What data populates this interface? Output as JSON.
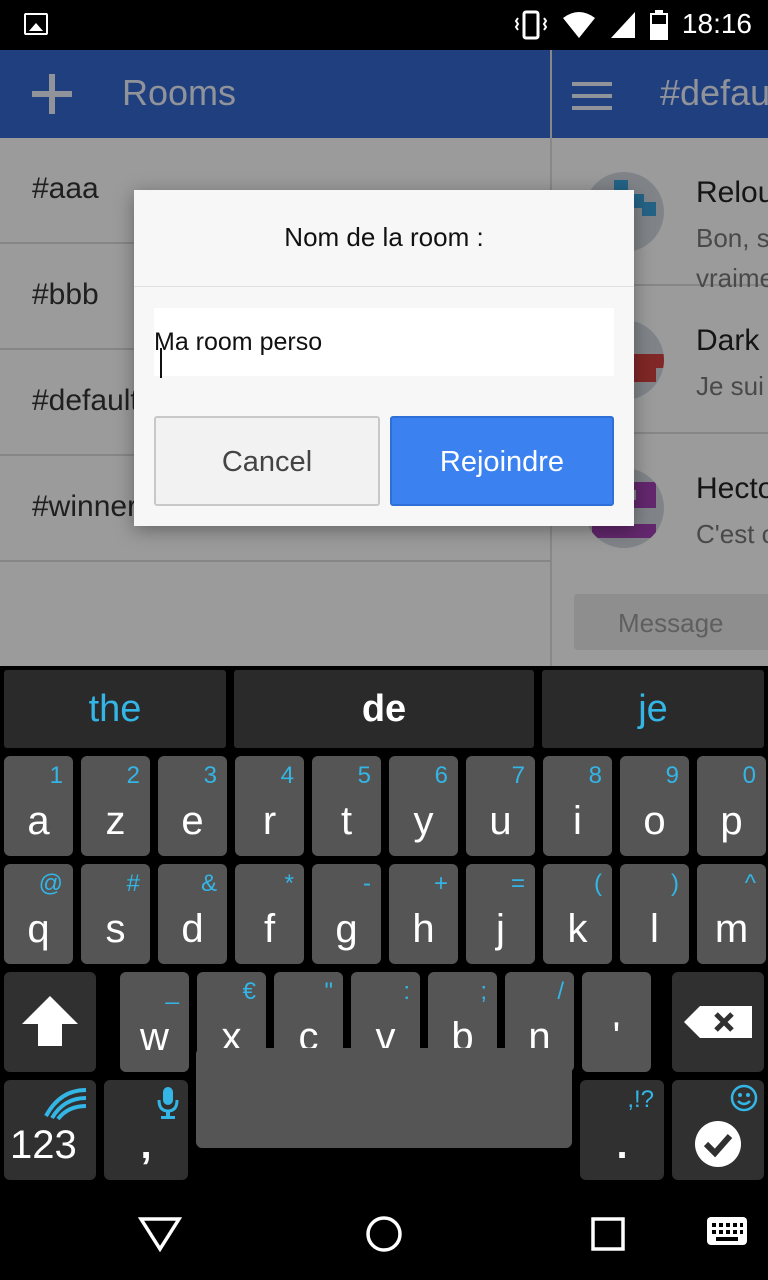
{
  "status_bar": {
    "time": "18:16"
  },
  "left_pane": {
    "title": "Rooms",
    "rooms": [
      "#aaa",
      "#bbb",
      "#default",
      "#winners are here"
    ]
  },
  "right_pane": {
    "title": "#default",
    "messages": [
      {
        "name": "Relou",
        "text": "Bon, s",
        "text2": "vraime"
      },
      {
        "name": "Dark",
        "text": "Je sui",
        "text2": ""
      },
      {
        "name": "Hecto",
        "text": "C'est c",
        "text2": ""
      }
    ],
    "message_placeholder": "Message"
  },
  "dialog": {
    "title": "Nom de la room :",
    "input_value": "Ma room perso",
    "cancel_label": "Cancel",
    "join_label": "Rejoindre"
  },
  "keyboard": {
    "suggestions": [
      "the",
      "de",
      "je"
    ],
    "row1": [
      {
        "k": "a",
        "a": "1"
      },
      {
        "k": "z",
        "a": "2"
      },
      {
        "k": "e",
        "a": "3"
      },
      {
        "k": "r",
        "a": "4"
      },
      {
        "k": "t",
        "a": "5"
      },
      {
        "k": "y",
        "a": "6"
      },
      {
        "k": "u",
        "a": "7"
      },
      {
        "k": "i",
        "a": "8"
      },
      {
        "k": "o",
        "a": "9"
      },
      {
        "k": "p",
        "a": "0"
      }
    ],
    "row2": [
      {
        "k": "q",
        "a": "@"
      },
      {
        "k": "s",
        "a": "#"
      },
      {
        "k": "d",
        "a": "&"
      },
      {
        "k": "f",
        "a": "*"
      },
      {
        "k": "g",
        "a": "-"
      },
      {
        "k": "h",
        "a": "+"
      },
      {
        "k": "j",
        "a": "="
      },
      {
        "k": "k",
        "a": "("
      },
      {
        "k": "l",
        "a": ")"
      },
      {
        "k": "m",
        "a": "^"
      }
    ],
    "row3": [
      {
        "k": "w",
        "a": "_"
      },
      {
        "k": "x",
        "a": "€"
      },
      {
        "k": "c",
        "a": "\""
      },
      {
        "k": "v",
        "a": ":"
      },
      {
        "k": "b",
        "a": ";"
      },
      {
        "k": "n",
        "a": "/"
      },
      {
        "k": "'",
        "a": ""
      }
    ],
    "numbers_label": "123",
    "comma_label": ",",
    "period_label": ".",
    "period_alt": ",!?"
  },
  "colors": {
    "app_bar": "#3366cc",
    "accent": "#33b5e5",
    "primary_button": "#3b82f0"
  }
}
